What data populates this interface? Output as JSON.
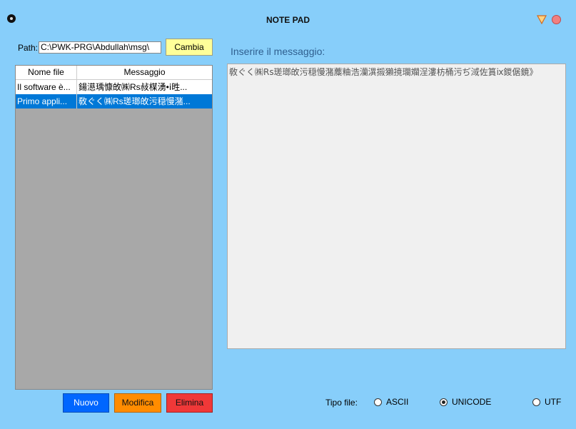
{
  "window": {
    "title": "NOTE PAD"
  },
  "path": {
    "label": "Path:",
    "value": "C:\\PWK-PRG\\Abdullah\\msg\\",
    "change_button": "Cambia"
  },
  "message": {
    "label": "Inserire il messaggio:",
    "text": "敎ぐく㈱Rs瑳瑯敀污穏慢潴蘪粬浩灡潩摋獺摬瓓斕浧漊枋桶污ぢ淢佐篔ⅸ鍐倨鏡》"
  },
  "table": {
    "columns": [
      "Nome file",
      "Messaggio"
    ],
    "rows": [
      {
        "name": "Il software è...",
        "message": "鍚濨瑀慷敀㈱Rs敊楳湧•ⅰ甠..."
      },
      {
        "name": "Primo appli...",
        "message": "敎ぐく㈱Rs瑳瑯敀污穏慢潴..."
      }
    ],
    "selected_index": 1
  },
  "actions": {
    "new": "Nuovo",
    "edit": "Modifica",
    "delete": "Elimina"
  },
  "file_type": {
    "label": "Tipo file:",
    "options": [
      "ASCII",
      "UNICODE",
      "UTF"
    ],
    "selected": "UNICODE"
  },
  "icons": {
    "app": "app-icon",
    "minimize": "minimize-icon",
    "close": "close-icon"
  },
  "colors": {
    "background": "#87CEFA",
    "selection": "#0078D7",
    "new": "#0066FF",
    "edit": "#FF8C00",
    "delete": "#F03838",
    "cambia": "#FFFF99"
  }
}
